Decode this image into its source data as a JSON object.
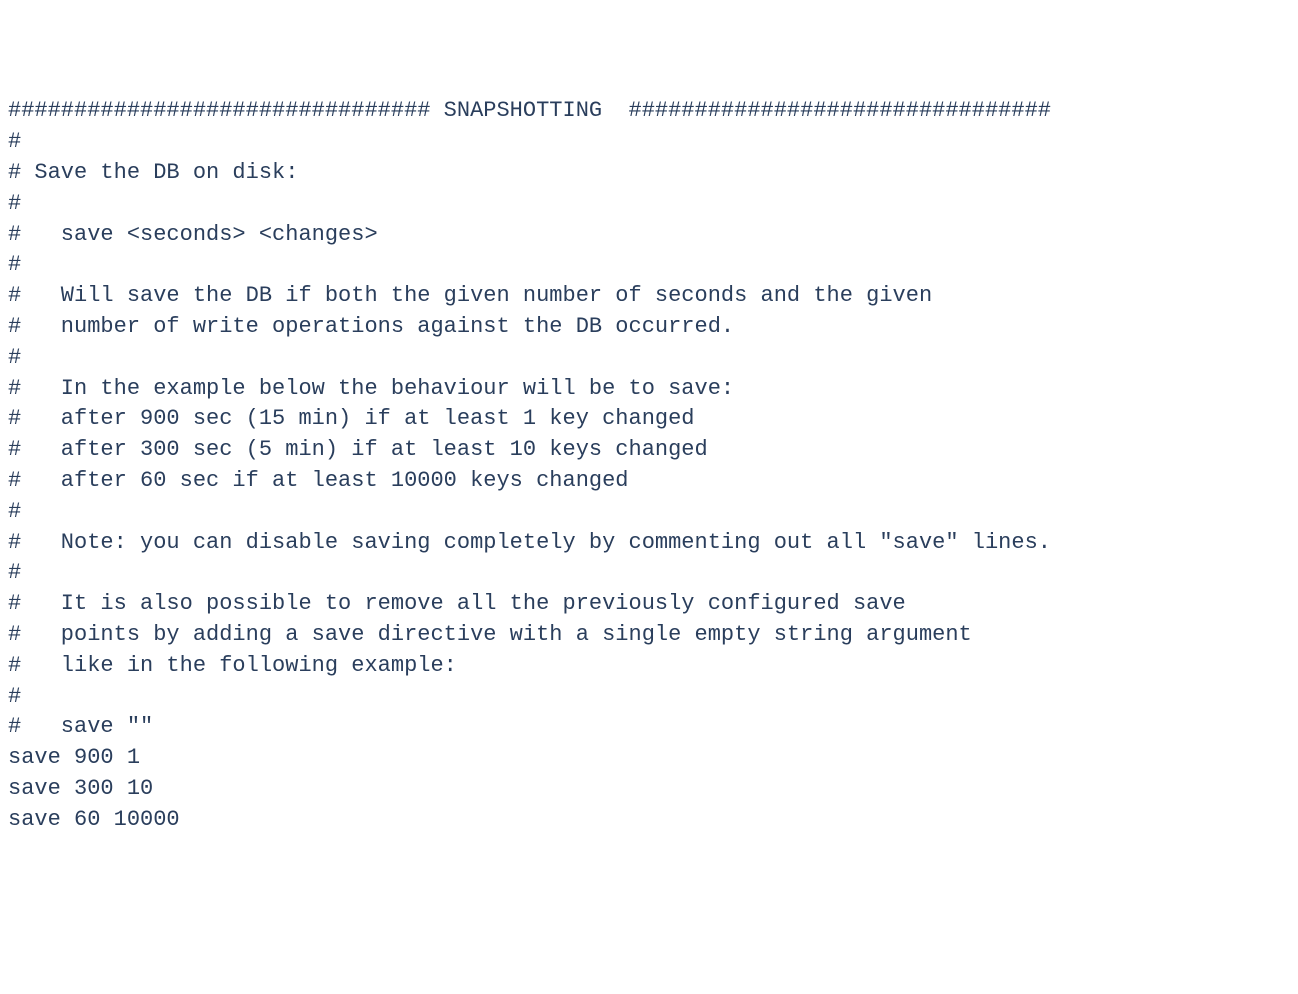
{
  "config": {
    "lines": [
      "################################ SNAPSHOTTING  ################################",
      "#",
      "# Save the DB on disk:",
      "#",
      "#   save <seconds> <changes>",
      "#",
      "#   Will save the DB if both the given number of seconds and the given",
      "#   number of write operations against the DB occurred.",
      "#",
      "#   In the example below the behaviour will be to save:",
      "#   after 900 sec (15 min) if at least 1 key changed",
      "#   after 300 sec (5 min) if at least 10 keys changed",
      "#   after 60 sec if at least 10000 keys changed",
      "#",
      "#   Note: you can disable saving completely by commenting out all \"save\" lines.",
      "#",
      "#   It is also possible to remove all the previously configured save",
      "#   points by adding a save directive with a single empty string argument",
      "#   like in the following example:",
      "#",
      "#   save \"\"",
      "",
      "save 900 1",
      "save 300 10",
      "save 60 10000"
    ]
  }
}
